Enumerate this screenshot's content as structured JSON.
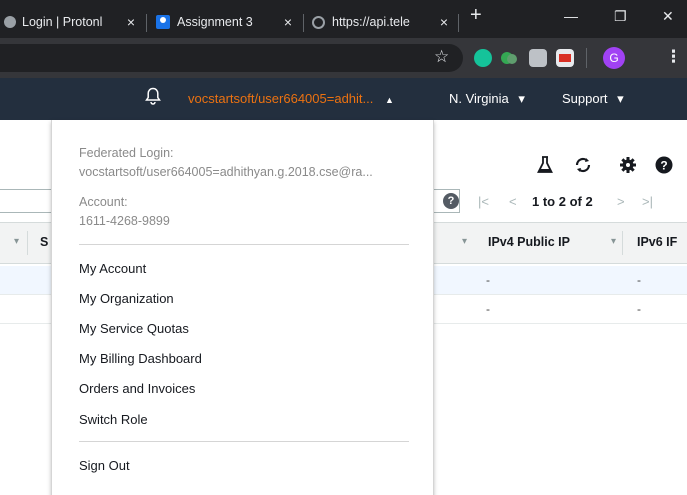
{
  "browser": {
    "tabs": [
      {
        "label": "Login | Protonl",
        "close": "×"
      },
      {
        "label": "Assignment 3",
        "close": "×"
      },
      {
        "label": "https://api.tele",
        "close": "×"
      }
    ],
    "new_tab": "+",
    "window_controls": {
      "minimize": "—",
      "restore": "❐",
      "close": "✕"
    },
    "toolbar": {
      "star": "☆",
      "menu": "⋮",
      "profile_initial": "G"
    }
  },
  "aws_header": {
    "account_menu": "vocstartsoft/user664005=adhit...",
    "account_caret": "▲",
    "region": "N. Virginia",
    "region_caret": "▾",
    "support": "Support",
    "support_caret": "▾",
    "bell": "🔔"
  },
  "page": {
    "tool_icons": {
      "beaker": "⚗",
      "refresh": "⟳",
      "settings": "⚙",
      "help": "❓"
    },
    "pagination": {
      "help": "?",
      "first": "|<",
      "prev": "<",
      "range": "1 to 2 of 2",
      "next": ">",
      "last": ">|"
    },
    "columns": [
      {
        "label": "",
        "caret": "▾"
      },
      {
        "label": "S",
        "caret": ""
      },
      {
        "label": "",
        "caret": "▾"
      },
      {
        "label": "IPv4 Public IP",
        "caret": "▾"
      },
      {
        "label": "IPv6 IF",
        "caret": ""
      }
    ],
    "rows": [
      {
        "ipv4": "-",
        "ipv6": "-"
      },
      {
        "ipv4": "-",
        "ipv6": "-"
      }
    ]
  },
  "dropdown": {
    "federated_label": "Federated Login:",
    "federated_value": "vocstartsoft/user664005=adhithyan.g.2018.cse@ra...",
    "account_label": "Account:",
    "account_value": "1611-4268-9899",
    "items": [
      "My Account",
      "My Organization",
      "My Service Quotas",
      "My Billing Dashboard",
      "Orders and Invoices",
      "Switch Role"
    ],
    "sign_out": "Sign Out"
  },
  "colors": {
    "accent_orange": "#ec7211",
    "header_bg": "#232f3e",
    "chrome_dark": "#202124"
  }
}
